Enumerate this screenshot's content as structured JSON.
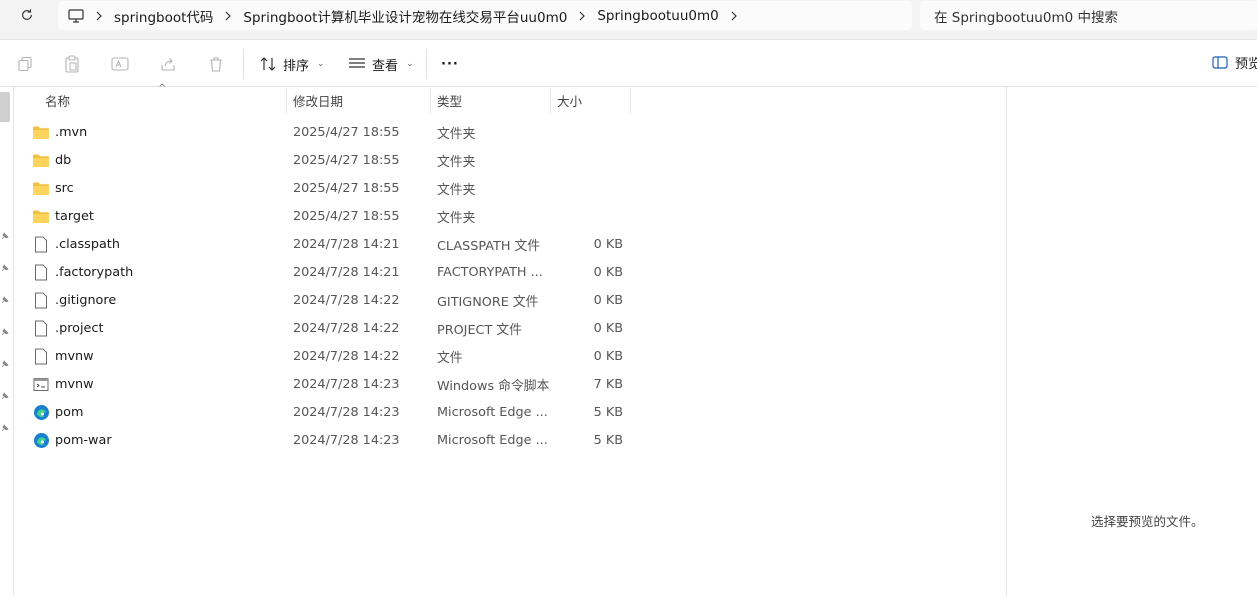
{
  "address": {
    "crumbs": [
      "springboot代码",
      "Springboot计算机毕业设计宠物在线交易平台uu0m0",
      "Springbootuu0m0"
    ]
  },
  "search": {
    "placeholder": "在 Springbootuu0m0 中搜索"
  },
  "toolbar": {
    "sort_label": "排序",
    "view_label": "查看",
    "more_label": "···",
    "preview_label": "预览"
  },
  "columns": {
    "name": "名称",
    "date": "修改日期",
    "type": "类型",
    "size": "大小"
  },
  "files": [
    {
      "name": ".mvn",
      "date": "2025/4/27 18:55",
      "type": "文件夹",
      "size": "",
      "icon": "folder-icon"
    },
    {
      "name": "db",
      "date": "2025/4/27 18:55",
      "type": "文件夹",
      "size": "",
      "icon": "folder-icon"
    },
    {
      "name": "src",
      "date": "2025/4/27 18:55",
      "type": "文件夹",
      "size": "",
      "icon": "folder-icon"
    },
    {
      "name": "target",
      "date": "2025/4/27 18:55",
      "type": "文件夹",
      "size": "",
      "icon": "folder-icon"
    },
    {
      "name": ".classpath",
      "date": "2024/7/28 14:21",
      "type": "CLASSPATH 文件",
      "size": "0 KB",
      "icon": "file-icon"
    },
    {
      "name": ".factorypath",
      "date": "2024/7/28 14:21",
      "type": "FACTORYPATH ...",
      "size": "0 KB",
      "icon": "file-icon"
    },
    {
      "name": ".gitignore",
      "date": "2024/7/28 14:22",
      "type": "GITIGNORE 文件",
      "size": "0 KB",
      "icon": "file-icon"
    },
    {
      "name": ".project",
      "date": "2024/7/28 14:22",
      "type": "PROJECT 文件",
      "size": "0 KB",
      "icon": "file-icon"
    },
    {
      "name": "mvnw",
      "date": "2024/7/28 14:22",
      "type": "文件",
      "size": "0 KB",
      "icon": "file-icon"
    },
    {
      "name": "mvnw",
      "date": "2024/7/28 14:23",
      "type": "Windows 命令脚本",
      "size": "7 KB",
      "icon": "script-icon"
    },
    {
      "name": "pom",
      "date": "2024/7/28 14:23",
      "type": "Microsoft Edge ...",
      "size": "5 KB",
      "icon": "edge-icon"
    },
    {
      "name": "pom-war",
      "date": "2024/7/28 14:23",
      "type": "Microsoft Edge ...",
      "size": "5 KB",
      "icon": "edge-icon"
    }
  ],
  "preview_pane": {
    "message": "选择要预览的文件。"
  }
}
